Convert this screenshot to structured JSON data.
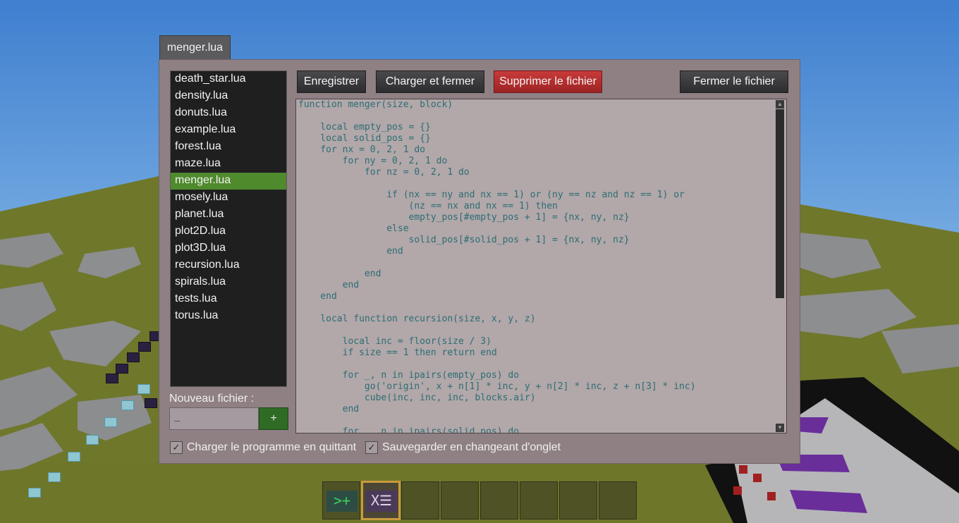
{
  "tab": {
    "label": "menger.lua"
  },
  "files": [
    "death_star.lua",
    "density.lua",
    "donuts.lua",
    "example.lua",
    "forest.lua",
    "maze.lua",
    "menger.lua",
    "mosely.lua",
    "planet.lua",
    "plot2D.lua",
    "plot3D.lua",
    "recursion.lua",
    "spirals.lua",
    "tests.lua",
    "torus.lua"
  ],
  "selected_file": "menger.lua",
  "toolbar": {
    "save_label": "Enregistrer",
    "load_close_label": "Charger et fermer",
    "delete_label": "Supprimer le fichier",
    "close_label": "Fermer le fichier"
  },
  "new_file": {
    "label": "Nouveau fichier :",
    "value": "_",
    "add_label": "+"
  },
  "editor": {
    "code": "function menger(size, block)\n\n    local empty_pos = {}\n    local solid_pos = {}\n    for nx = 0, 2, 1 do\n        for ny = 0, 2, 1 do\n            for nz = 0, 2, 1 do\n\n                if (nx == ny and nx == 1) or (ny == nz and nz == 1) or\n                    (nz == nx and nx == 1) then\n                    empty_pos[#empty_pos + 1] = {nx, ny, nz}\n                else\n                    solid_pos[#solid_pos + 1] = {nx, ny, nz}\n                end\n\n            end\n        end\n    end\n\n    local function recursion(size, x, y, z)\n\n        local inc = floor(size / 3)\n        if size == 1 then return end\n\n        for _, n in ipairs(empty_pos) do\n            go('origin', x + n[1] * inc, y + n[2] * inc, z + n[3] * inc)\n            cube(inc, inc, inc, blocks.air)\n        end\n\n        for _, n in ipairs(solid_pos) do"
  },
  "options": {
    "load_on_quit": {
      "label": "Charger le programme en quittant",
      "checked": true
    },
    "save_on_tab_change": {
      "label": "Sauvegarder en changeant d'onglet",
      "checked": true
    }
  },
  "checkbox_glyph": "✓",
  "scroll_up_glyph": "▲",
  "scroll_down_glyph": "▼",
  "hotbar": {
    "slots": 8,
    "active_slot": 2,
    "slot1_icon": "terminal-icon",
    "slot1_text": ">+",
    "slot2_icon": "editor-icon",
    "slot2_text": "X☰"
  }
}
